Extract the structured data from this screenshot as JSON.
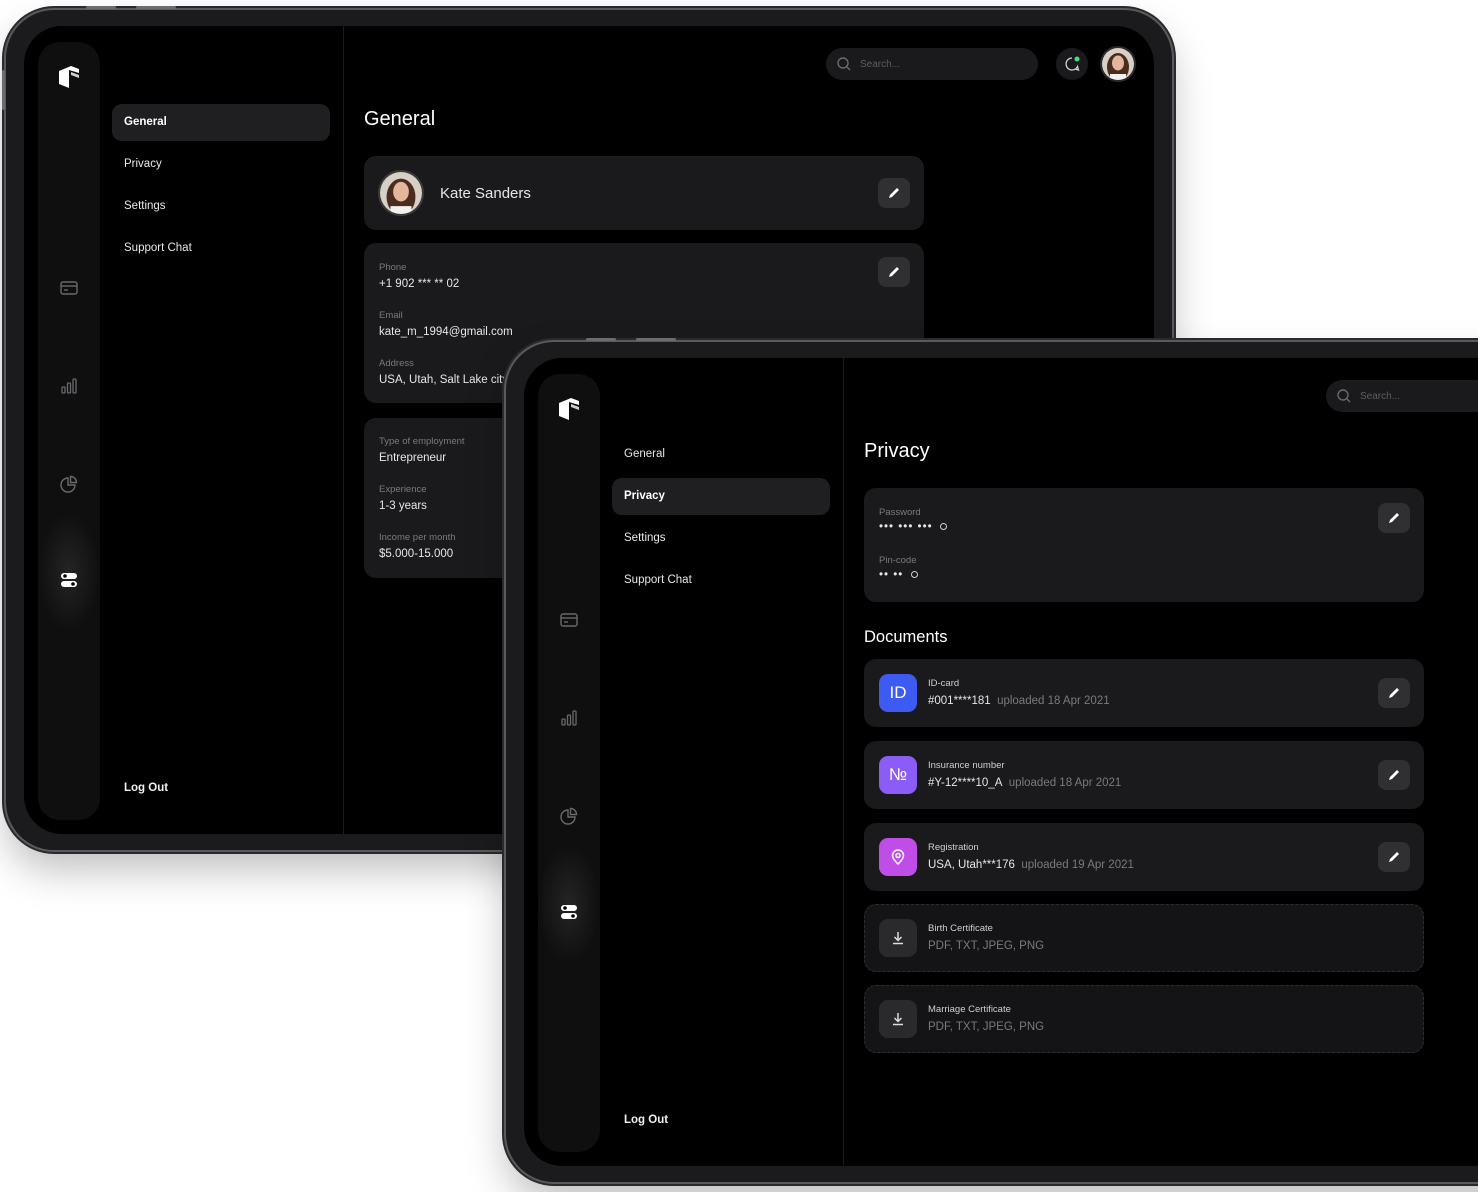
{
  "colors": {
    "id_icon_bg": "#3d5af1",
    "insurance_icon_bg": "#8b5cf6",
    "registration_icon_bg": "#c04de8",
    "accent_bg": "#1a1a1c"
  },
  "icons": {
    "rail": [
      "logo-icon",
      "card-icon",
      "bar-chart-icon",
      "pie-chart-icon",
      "toggles-icon"
    ],
    "edit": "pencil-icon",
    "search": "search-icon",
    "notification": "chat-notification-icon",
    "download": "download-icon",
    "registration": "location-pin-icon"
  },
  "tabletA": {
    "search": {
      "placeholder": "Search..."
    },
    "menu": {
      "items": [
        {
          "label": "General",
          "active": true
        },
        {
          "label": "Privacy",
          "active": false
        },
        {
          "label": "Settings",
          "active": false
        },
        {
          "label": "Support Chat",
          "active": false
        }
      ],
      "logout": "Log Out"
    },
    "page_title": "General",
    "profile": {
      "name": "Kate Sanders"
    },
    "contact": {
      "phone_label": "Phone",
      "phone": "+1 902 *** ** 02",
      "email_label": "Email",
      "email": "kate_m_1994@gmail.com",
      "address_label": "Address",
      "address": "USA, Utah, Salt Lake city,"
    },
    "work": {
      "employment_label": "Type of employment",
      "employment": "Entrepreneur",
      "experience_label": "Experience",
      "experience": "1-3 years",
      "income_label": "Income per month",
      "income": "$5.000-15.000"
    }
  },
  "tabletB": {
    "search": {
      "placeholder": "Search..."
    },
    "menu": {
      "items": [
        {
          "label": "General",
          "active": false
        },
        {
          "label": "Privacy",
          "active": true
        },
        {
          "label": "Settings",
          "active": false
        },
        {
          "label": "Support Chat",
          "active": false
        }
      ],
      "logout": "Log Out"
    },
    "page_title": "Privacy",
    "security": {
      "password_label": "Password",
      "password": "••• ••• •••",
      "pin_label": "Pin-code",
      "pin": "•• ••"
    },
    "documents_title": "Documents",
    "documents": [
      {
        "icon_text": "ID",
        "title": "ID-card",
        "value": "#001****181",
        "uploaded": "uploaded 18 Apr 2021"
      },
      {
        "icon_text": "№",
        "title": "Insurance number",
        "value": "#Y-12****10_A",
        "uploaded": "uploaded 18 Apr 2021"
      },
      {
        "icon_text": "",
        "title": "Registration",
        "value": "USA, Utah***176",
        "uploaded": "uploaded 19 Apr 2021"
      },
      {
        "title": "Birth Certificate",
        "formats": "PDF, TXT, JPEG, PNG"
      },
      {
        "title": "Marriage Certificate",
        "formats": "PDF, TXT, JPEG, PNG"
      }
    ]
  }
}
